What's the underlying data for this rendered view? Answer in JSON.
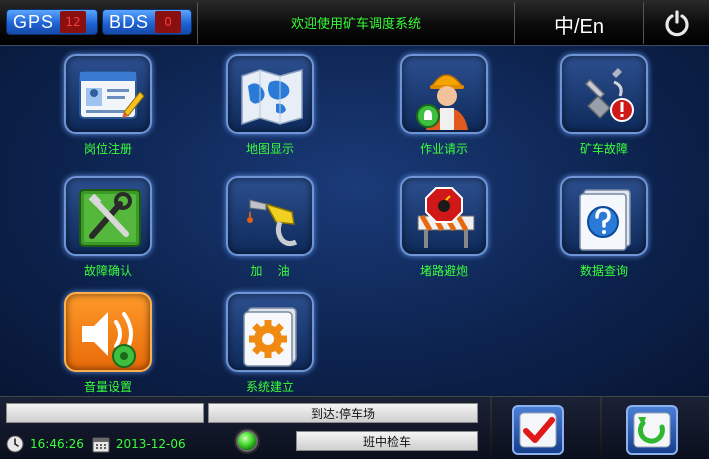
{
  "header": {
    "gps_label": "GPS",
    "gps_count": "12",
    "bds_label": "BDS",
    "bds_count": "0",
    "welcome": "欢迎使用矿车调度系统",
    "language_toggle": "中/En"
  },
  "menu": {
    "items": [
      {
        "label": "岗位注册",
        "icon": "id-card-icon"
      },
      {
        "label": "地图显示",
        "icon": "map-icon"
      },
      {
        "label": "作业请示",
        "icon": "worker-icon"
      },
      {
        "label": "矿车故障",
        "icon": "fault-icon"
      },
      {
        "label": "故障确认",
        "icon": "tools-icon"
      },
      {
        "label": "加    油",
        "icon": "fuel-nozzle-icon"
      },
      {
        "label": "堵路避炮",
        "icon": "road-block-icon"
      },
      {
        "label": "数据查询",
        "icon": "query-icon"
      },
      {
        "label": "音量设置",
        "icon": "volume-icon"
      },
      {
        "label": "系统建立",
        "icon": "settings-gear-icon"
      }
    ]
  },
  "footer": {
    "left_field": "",
    "destination": "到达:停车场",
    "time": "16:46:26",
    "date": "2013-12-06",
    "status": "班中检车"
  },
  "colors": {
    "accent_green": "#3aff3a",
    "badge_red": "#8a0f0f",
    "signal_blue": "#1c5fd0"
  }
}
